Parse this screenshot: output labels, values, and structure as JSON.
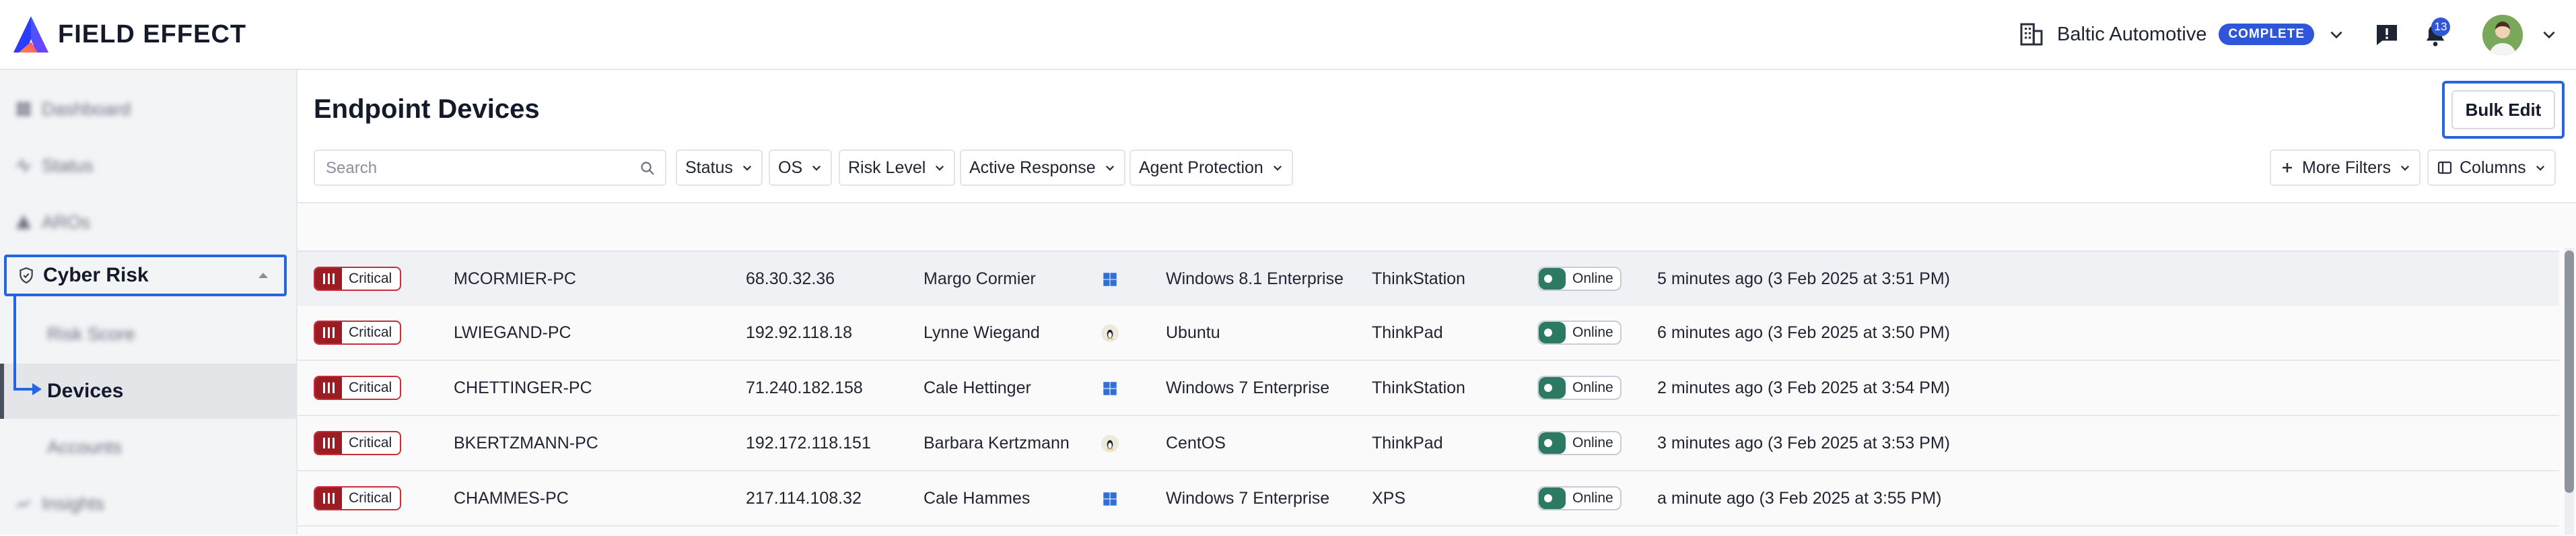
{
  "brand": {
    "name": "FIELD EFFECT"
  },
  "header": {
    "org_name": "Baltic Automotive",
    "org_status": "COMPLETE",
    "notification_count": "13"
  },
  "sidebar": {
    "items": [
      {
        "label": "Dashboard",
        "icon": "grid-icon"
      },
      {
        "label": "Status",
        "icon": "pulse-icon"
      },
      {
        "label": "AROs",
        "icon": "alert-icon"
      },
      {
        "label": "Cyber Risk",
        "icon": "shield-icon"
      },
      {
        "label": "Risk Score"
      },
      {
        "label": "Devices"
      },
      {
        "label": "Accounts"
      },
      {
        "label": "Insights",
        "icon": "chart-icon"
      }
    ]
  },
  "main": {
    "title": "Endpoint Devices",
    "bulk_edit_label": "Bulk Edit",
    "search_placeholder": "Search",
    "filters": [
      "Status",
      "OS",
      "Risk Level",
      "Active Response",
      "Agent Protection"
    ],
    "more_filters_label": "More Filters",
    "columns_label": "Columns"
  },
  "devices": [
    {
      "risk": "Critical",
      "name": "MCORMIER-PC",
      "ip": "68.30.32.36",
      "user": "Margo Cormier",
      "os_icon": "windows-icon",
      "os": "Windows 8.1 Enterprise",
      "model": "ThinkStation",
      "status": "Online",
      "last_seen": "5 minutes ago (3 Feb 2025 at 3:51 PM)"
    },
    {
      "risk": "Critical",
      "name": "LWIEGAND-PC",
      "ip": "192.92.118.18",
      "user": "Lynne Wiegand",
      "os_icon": "linux-icon",
      "os": "Ubuntu",
      "model": "ThinkPad",
      "status": "Online",
      "last_seen": "6 minutes ago (3 Feb 2025 at 3:50 PM)"
    },
    {
      "risk": "Critical",
      "name": "CHETTINGER-PC",
      "ip": "71.240.182.158",
      "user": "Cale Hettinger",
      "os_icon": "windows-icon",
      "os": "Windows 7 Enterprise",
      "model": "ThinkStation",
      "status": "Online",
      "last_seen": "2 minutes ago (3 Feb 2025 at 3:54 PM)"
    },
    {
      "risk": "Critical",
      "name": "BKERTZMANN-PC",
      "ip": "192.172.118.151",
      "user": "Barbara Kertzmann",
      "os_icon": "linux-icon",
      "os": "CentOS",
      "model": "ThinkPad",
      "status": "Online",
      "last_seen": "3 minutes ago (3 Feb 2025 at 3:53 PM)"
    },
    {
      "risk": "Critical",
      "name": "CHAMMES-PC",
      "ip": "217.114.108.32",
      "user": "Cale Hammes",
      "os_icon": "windows-icon",
      "os": "Windows 7 Enterprise",
      "model": "XPS",
      "status": "Online",
      "last_seen": "a minute ago (3 Feb 2025 at 3:55 PM)"
    }
  ],
  "colors": {
    "accent": "#2566e0",
    "badge": "#2f56d8",
    "critical": "#9b1c22",
    "online": "#2c7a63"
  }
}
